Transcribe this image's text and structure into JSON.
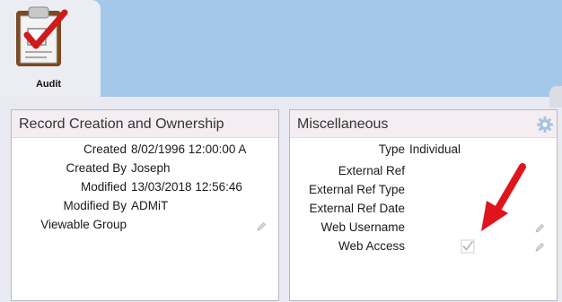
{
  "audit_tab": {
    "label": "Audit",
    "icon": "clipboard-check-icon"
  },
  "record_panel": {
    "title": "Record Creation and Ownership",
    "fields": [
      {
        "label": "Created",
        "value": "8/02/1996 12:00:00 A"
      },
      {
        "label": "Created By",
        "value": "Joseph"
      },
      {
        "label": "Modified",
        "value": "13/03/2018 12:56:46"
      },
      {
        "label": "Modified By",
        "value": "ADMiT"
      },
      {
        "label": "Viewable Group",
        "value": ""
      }
    ]
  },
  "misc_panel": {
    "title": "Miscellaneous",
    "fields": [
      {
        "label": "Type",
        "value": "Individual"
      },
      {
        "label": "External Ref",
        "value": ""
      },
      {
        "label": "External Ref Type",
        "value": ""
      },
      {
        "label": "External Ref Date",
        "value": ""
      },
      {
        "label": "Web Username",
        "value": ""
      },
      {
        "label": "Web Access",
        "checked": true
      }
    ]
  },
  "colors": {
    "top_band": "#a3c8ea",
    "panel_header": "#f4eef2",
    "annotation_arrow": "#e0141c"
  }
}
